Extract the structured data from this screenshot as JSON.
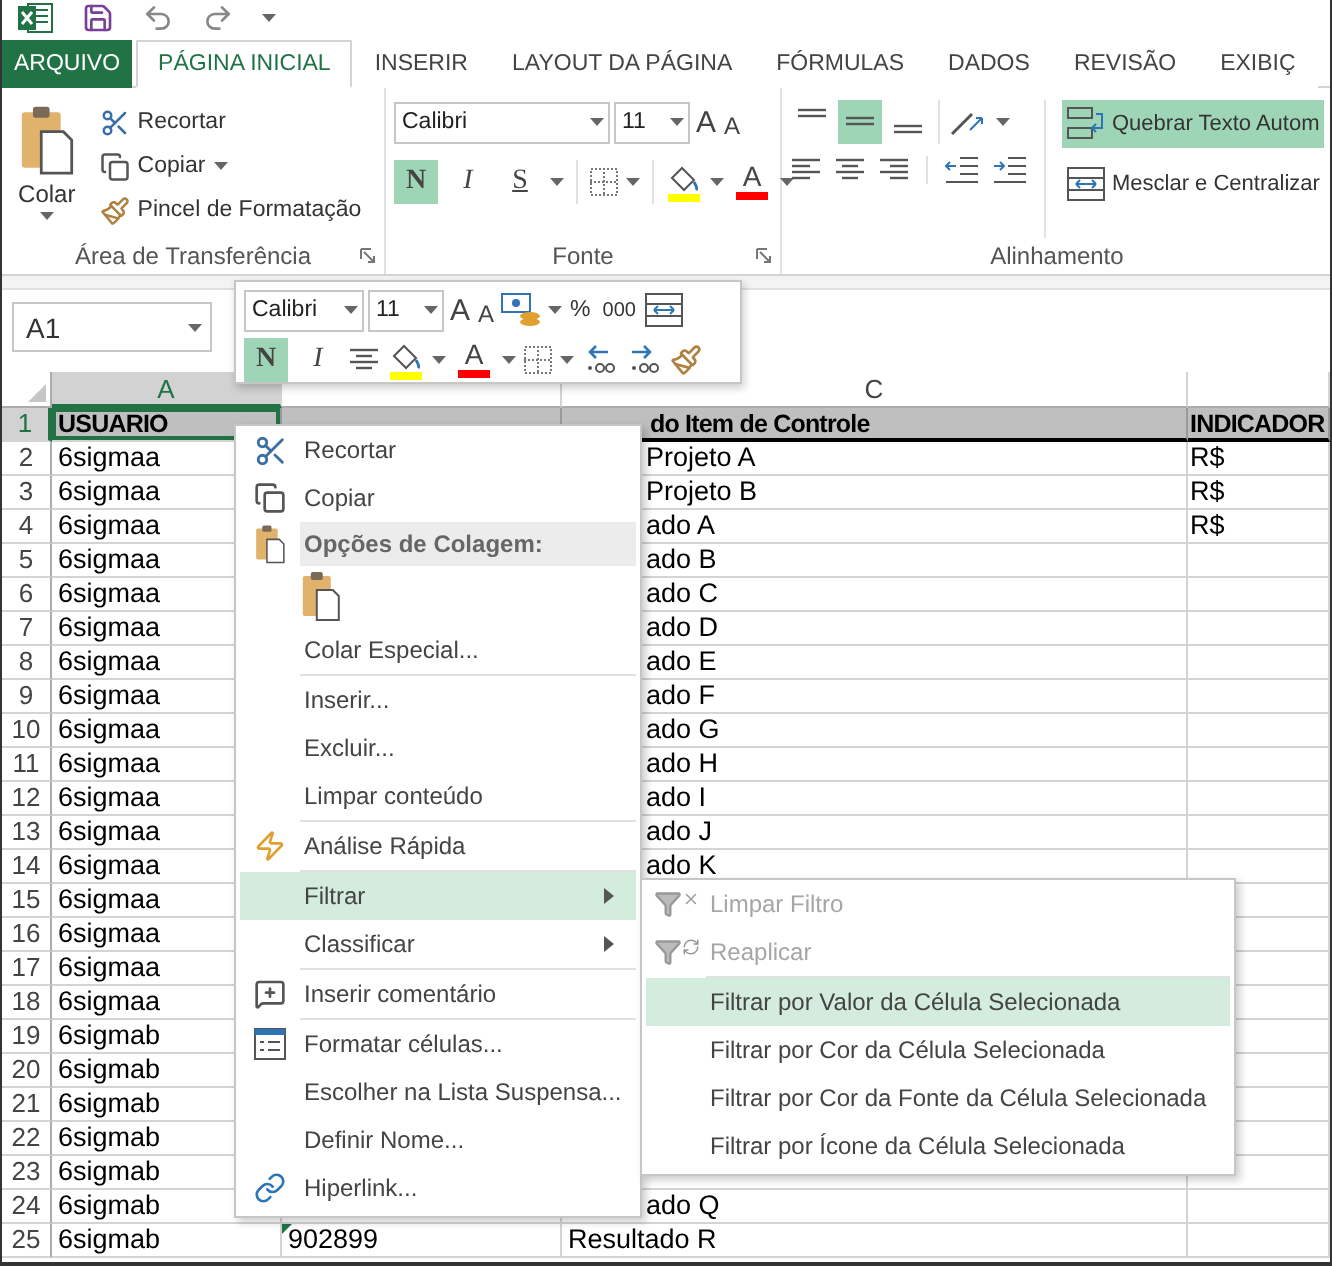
{
  "tabs": [
    {
      "label": "ARQUIVO",
      "kind": "file",
      "selected": false
    },
    {
      "label": "PÁGINA INICIAL",
      "kind": "tab",
      "selected": true
    },
    {
      "label": "INSERIR",
      "kind": "tab",
      "selected": false
    },
    {
      "label": "LAYOUT DA PÁGINA",
      "kind": "tab",
      "selected": false
    },
    {
      "label": "FÓRMULAS",
      "kind": "tab",
      "selected": false
    },
    {
      "label": "DADOS",
      "kind": "tab",
      "selected": false
    },
    {
      "label": "REVISÃO",
      "kind": "tab",
      "selected": false
    },
    {
      "label": "EXIBIÇ",
      "kind": "tab",
      "selected": false
    }
  ],
  "clipboard": {
    "paste": "Colar",
    "actions": [
      "Recortar",
      "Copiar",
      "Pincel de Formatação"
    ],
    "label": "Área de Transferência"
  },
  "font": {
    "family": "Calibri",
    "size": "11",
    "grow": "A",
    "shrink": "A",
    "styles": [
      {
        "label": "N",
        "kind": "bold",
        "selected": true
      },
      {
        "label": "I",
        "kind": "italic",
        "selected": false
      },
      {
        "label": "S",
        "kind": "underline",
        "selected": false
      }
    ],
    "color_label": "A",
    "label": "Fonte"
  },
  "alignment": {
    "vertical": [
      {
        "kind": "top",
        "selected": false
      },
      {
        "kind": "middle",
        "selected": true
      },
      {
        "kind": "bottom",
        "selected": false
      }
    ],
    "wrap": {
      "label": "Quebrar Texto Autom",
      "selected": true
    },
    "merge": "Mesclar e Centralizar",
    "label": "Alinhamento"
  },
  "name_box": "A1",
  "mini_toolbar": {
    "family": "Calibri",
    "size": "11",
    "grow": "A",
    "shrink": "A",
    "percent": "%",
    "thousands": "000",
    "styles": [
      {
        "label": "N",
        "kind": "bold",
        "selected": true
      },
      {
        "label": "I",
        "kind": "italic",
        "selected": false
      }
    ],
    "color_label": "A"
  },
  "sheet": {
    "columns": [
      {
        "label": "A",
        "selected": true
      },
      {
        "label": "C",
        "selected": false
      }
    ],
    "rows": [
      {
        "number": "1",
        "selected": true,
        "A": "USUARIO",
        "C": "do Item de Controle",
        "D": "INDICADOR"
      },
      {
        "number": "2",
        "selected": false,
        "A": "6sigmaa",
        "C": "Projeto A",
        "D": "R$"
      },
      {
        "number": "3",
        "selected": false,
        "A": "6sigmaa",
        "C": "Projeto B",
        "D": "R$"
      },
      {
        "number": "4",
        "selected": false,
        "A": "6sigmaa",
        "C": "ado A",
        "D": "R$"
      },
      {
        "number": "5",
        "selected": false,
        "A": "6sigmaa",
        "C": "ado B"
      },
      {
        "number": "6",
        "selected": false,
        "A": "6sigmaa",
        "C": "ado C"
      },
      {
        "number": "7",
        "selected": false,
        "A": "6sigmaa",
        "C": "ado D"
      },
      {
        "number": "8",
        "selected": false,
        "A": "6sigmaa",
        "C": "ado E"
      },
      {
        "number": "9",
        "selected": false,
        "A": "6sigmaa",
        "C": "ado F"
      },
      {
        "number": "10",
        "selected": false,
        "A": "6sigmaa",
        "C": "ado G"
      },
      {
        "number": "11",
        "selected": false,
        "A": "6sigmaa",
        "C": "ado H"
      },
      {
        "number": "12",
        "selected": false,
        "A": "6sigmaa",
        "C": "ado I"
      },
      {
        "number": "13",
        "selected": false,
        "A": "6sigmaa",
        "C": "ado J"
      },
      {
        "number": "14",
        "selected": false,
        "A": "6sigmaa",
        "C": "ado K"
      },
      {
        "number": "15",
        "selected": false,
        "A": "6sigmaa"
      },
      {
        "number": "16",
        "selected": false,
        "A": "6sigmaa"
      },
      {
        "number": "17",
        "selected": false,
        "A": "6sigmaa"
      },
      {
        "number": "18",
        "selected": false,
        "A": "6sigmaa"
      },
      {
        "number": "19",
        "selected": false,
        "A": "6sigmab"
      },
      {
        "number": "20",
        "selected": false,
        "A": "6sigmab"
      },
      {
        "number": "21",
        "selected": false,
        "A": "6sigmab"
      },
      {
        "number": "22",
        "selected": false,
        "A": "6sigmab"
      },
      {
        "number": "23",
        "selected": false,
        "A": "6sigmab"
      },
      {
        "number": "24",
        "selected": false,
        "A": "6sigmab",
        "C": "ado Q"
      },
      {
        "number": "25",
        "selected": false,
        "A": "6sigmab",
        "B": "902899",
        "C": "Resultado R"
      }
    ]
  },
  "context_menu": {
    "items": [
      {
        "kind": "item",
        "label": "Recortar",
        "selected": false
      },
      {
        "kind": "item",
        "label": "Copiar",
        "selected": false
      },
      {
        "kind": "header",
        "label": "Opções de Colagem:"
      },
      {
        "kind": "paste_options"
      },
      {
        "kind": "item",
        "label": "Colar Especial...",
        "selected": false
      },
      {
        "kind": "separator"
      },
      {
        "kind": "item",
        "label": "Inserir...",
        "selected": false
      },
      {
        "kind": "item",
        "label": "Excluir...",
        "selected": false
      },
      {
        "kind": "item",
        "label": "Limpar conteúdo",
        "selected": false
      },
      {
        "kind": "separator"
      },
      {
        "kind": "item",
        "label": "Análise Rápida",
        "selected": false
      },
      {
        "kind": "separator"
      },
      {
        "kind": "submenu",
        "label": "Filtrar",
        "selected": true
      },
      {
        "kind": "submenu",
        "label": "Classificar",
        "selected": false
      },
      {
        "kind": "separator"
      },
      {
        "kind": "item",
        "label": "Inserir comentário",
        "selected": false
      },
      {
        "kind": "separator"
      },
      {
        "kind": "item",
        "label": "Formatar células...",
        "selected": false
      },
      {
        "kind": "item",
        "label": "Escolher na Lista Suspensa...",
        "selected": false
      },
      {
        "kind": "item",
        "label": "Definir Nome...",
        "selected": false
      },
      {
        "kind": "item",
        "label": "Hiperlink...",
        "selected": false
      }
    ]
  },
  "submenu": {
    "items": [
      {
        "kind": "item",
        "label": "Limpar Filtro",
        "disabled": true,
        "selected": false
      },
      {
        "kind": "item",
        "label": "Reaplicar",
        "disabled": true,
        "selected": false
      },
      {
        "kind": "separator"
      },
      {
        "kind": "item",
        "label": "Filtrar por Valor da Célula Selecionada",
        "disabled": false,
        "selected": true
      },
      {
        "kind": "item",
        "label": "Filtrar por Cor da Célula Selecionada",
        "disabled": false,
        "selected": false
      },
      {
        "kind": "item",
        "label": "Filtrar por Cor da Fonte da Célula Selecionada",
        "disabled": false,
        "selected": false
      },
      {
        "kind": "item",
        "label": "Filtrar por Ícone da Célula Selecionada",
        "disabled": false,
        "selected": false
      }
    ]
  }
}
